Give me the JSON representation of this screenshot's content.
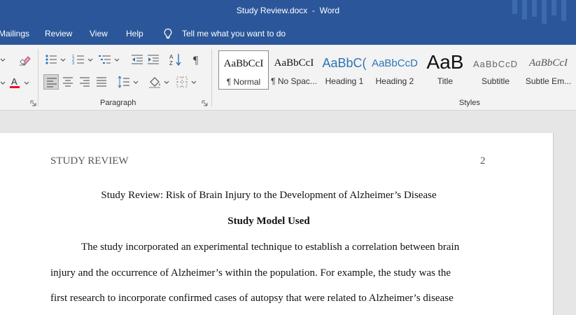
{
  "window": {
    "title": "Study Review.docx  -  Word"
  },
  "menu": {
    "tabs": [
      "Mailings",
      "Review",
      "View",
      "Help"
    ],
    "tell_me": "Tell me what you want to do"
  },
  "ribbon": {
    "paragraph_group_label": "Paragraph",
    "styles_group_label": "Styles",
    "icons": [
      "eraser-icon",
      "bullets-icon",
      "numbering-icon",
      "multilevel-list-icon",
      "decrease-indent-icon",
      "increase-indent-icon",
      "sort-icon",
      "pilcrow-icon",
      "font-color-icon",
      "align-left-icon",
      "center-icon",
      "align-right-icon",
      "justify-icon",
      "line-spacing-icon",
      "shading-icon",
      "borders-icon"
    ],
    "font_color": "#e81123",
    "styles": [
      {
        "sample": "AaBbCcI",
        "name": "¶ Normal",
        "selected": true
      },
      {
        "sample": "AaBbCcI",
        "name": "¶ No Spac..."
      },
      {
        "sample": "AaBbC(",
        "name": "Heading 1"
      },
      {
        "sample": "AaBbCcD",
        "name": "Heading 2"
      },
      {
        "sample": "AaB",
        "name": "Title"
      },
      {
        "sample": "AaBbCcD",
        "name": "Subtitle"
      },
      {
        "sample": "AaBbCcI",
        "name": "Subtle Em..."
      }
    ]
  },
  "colors": {
    "title_bar": "#2b579a",
    "ribbon": "#f3f3f3",
    "heading_blue": "#2e74b5"
  },
  "document": {
    "running_head": "STUDY REVIEW",
    "page_number": "2",
    "title": "Study Review: Risk of Brain Injury to the Development of Alzheimer’s Disease",
    "heading": "Study Model Used",
    "lines": [
      "The study incorporated an experimental technique to establish a correlation between brain",
      "injury and the occurrence of Alzheimer’s within the population. For example, the study was the",
      "first research to incorporate confirmed cases of autopsy that were related to Alzheimer’s disease"
    ]
  }
}
